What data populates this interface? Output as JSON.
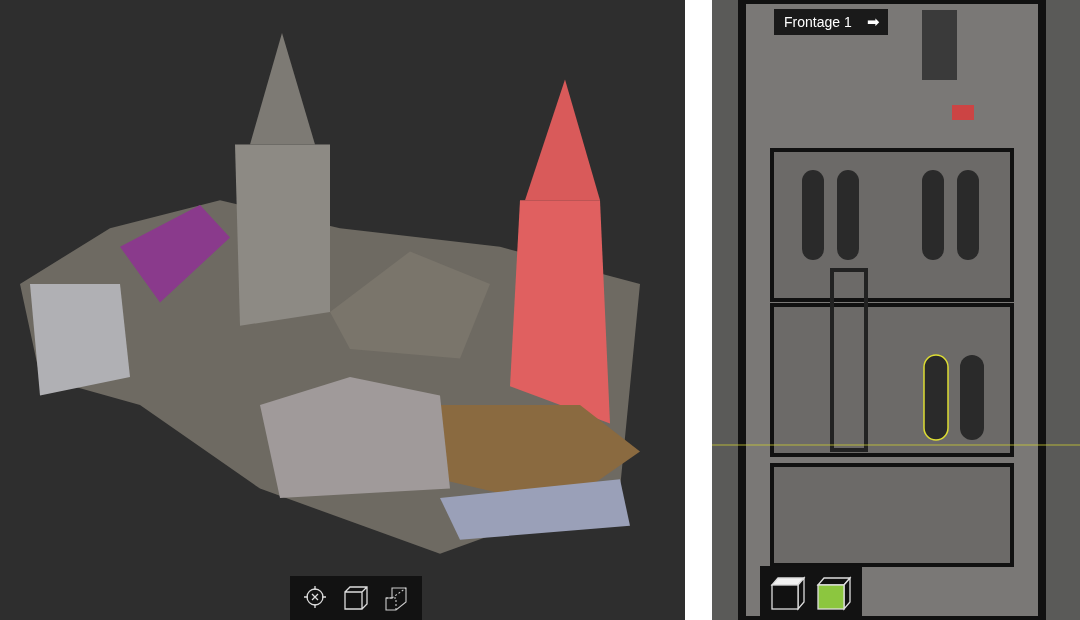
{
  "model_view": {
    "toolbar": [
      {
        "kind": "target"
      },
      {
        "kind": "cube"
      },
      {
        "kind": "plane"
      }
    ]
  },
  "elevation_view": {
    "frontage_label": "Frontage 1",
    "next_arrow": "➡",
    "view_buttons": [
      {
        "kind": "cube",
        "selected": false
      },
      {
        "kind": "cube",
        "selected": true
      }
    ]
  }
}
